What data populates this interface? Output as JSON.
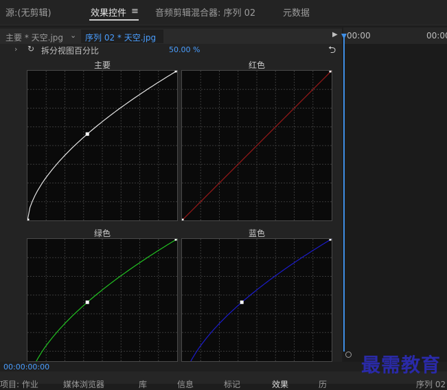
{
  "tabs": [
    {
      "label": "源:(无剪辑)"
    },
    {
      "label": "效果控件"
    },
    {
      "label": "音频剪辑混合器: 序列 02"
    },
    {
      "label": "元数据"
    }
  ],
  "effect_controls": {
    "master_clip": "主要 * 天空.jpg",
    "sequence_clip": "序列 02 * 天空.jpg",
    "property_label": "拆分视图百分比",
    "property_value": "50.00 %",
    "graphs": [
      {
        "label": "主要",
        "color": "#e6e6e6"
      },
      {
        "label": "红色",
        "color": "#9a1a1a"
      },
      {
        "label": "绿色",
        "color": "#22c422"
      },
      {
        "label": "蓝色",
        "color": "#1c1ccc"
      }
    ]
  },
  "timeline": {
    "ruler_start": "00:00",
    "ruler_next": "00:00",
    "current_timecode": "00:00:00:00"
  },
  "bottom_tabs": [
    {
      "label": "项目: 作业"
    },
    {
      "label": "媒体浏览器"
    },
    {
      "label": "库"
    },
    {
      "label": "信息"
    },
    {
      "label": "标记"
    },
    {
      "label": "效果"
    },
    {
      "label": "历"
    },
    {
      "label": "序列 02"
    }
  ],
  "watermark": "最需教育"
}
